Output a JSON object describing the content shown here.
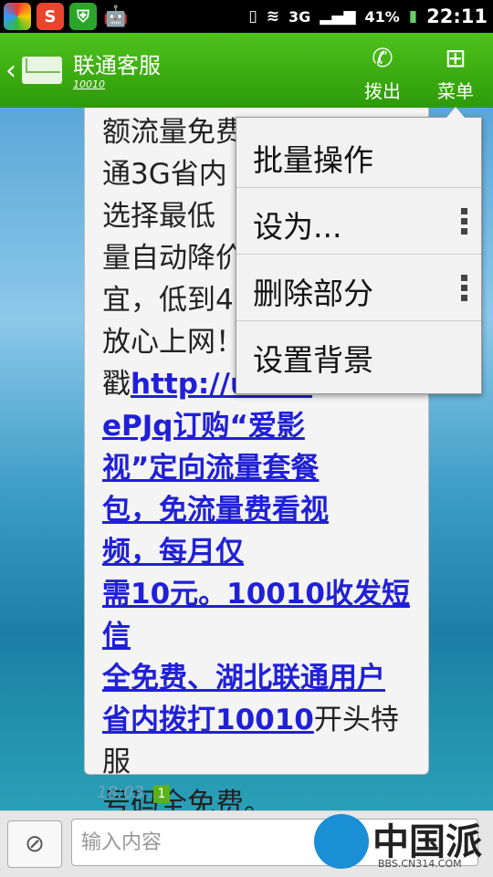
{
  "status_bar": {
    "signal_label": "3G",
    "battery_percent": "41%",
    "time": "22:11"
  },
  "header": {
    "contact_name": "联通客服",
    "contact_number": "10010",
    "call_label": "拨出",
    "menu_label": "菜单"
  },
  "message": {
    "lines": [
      "额流量免费",
      "通3G省内",
      "选择最低",
      "量自动降价",
      "宜，低到4",
      "放心上网！",
      "戳"
    ],
    "link_fragment": "http://u.a...",
    "link_lines": [
      "ePJq订购“爱影",
      "视”定向流量套餐",
      "包，免流量费看视",
      "频，每月仅",
      "需10元。10010收发短信",
      "全免费、湖北联通用户",
      "省内拨打10010"
    ],
    "tail_text": "开头特服",
    "last_line": "号码全免费。",
    "timestamp": "18:03",
    "sim_badge": "1"
  },
  "popup_menu": {
    "items": [
      {
        "label": "批量操作"
      },
      {
        "label": "设为..."
      },
      {
        "label": "删除部分"
      },
      {
        "label": "设置背景"
      }
    ]
  },
  "compose": {
    "placeholder": "输入内容"
  },
  "watermark": {
    "title": "中国派",
    "url": "BBS.CN314.COM"
  }
}
